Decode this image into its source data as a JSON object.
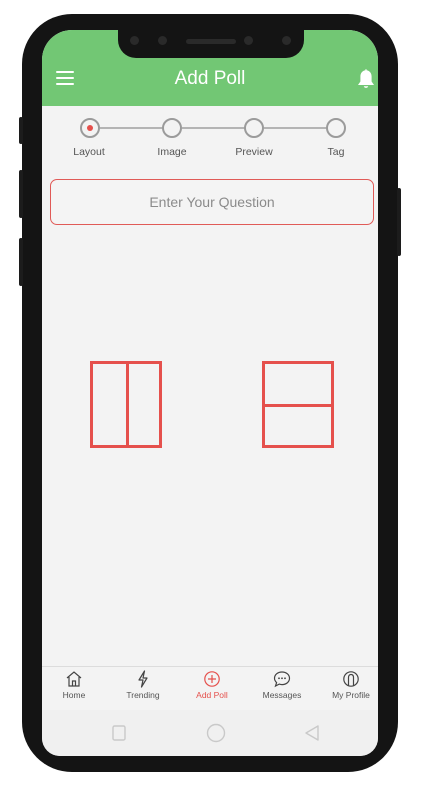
{
  "header": {
    "title": "Add Poll",
    "menu_icon": "hamburger-menu-icon",
    "bell_icon": "bell-icon"
  },
  "stepper": {
    "steps": [
      {
        "label": "Layout",
        "active": true
      },
      {
        "label": "Image",
        "active": false
      },
      {
        "label": "Preview",
        "active": false
      },
      {
        "label": "Tag",
        "active": false
      }
    ]
  },
  "question": {
    "placeholder": "Enter Your Question"
  },
  "layouts": [
    {
      "name": "two-columns",
      "icon": "split-vertical-layout-icon"
    },
    {
      "name": "two-rows",
      "icon": "split-horizontal-layout-icon"
    }
  ],
  "tabbar": {
    "tabs": [
      {
        "label": "Home",
        "icon": "home-icon"
      },
      {
        "label": "Trending",
        "icon": "lightning-icon"
      },
      {
        "label": "Add Poll",
        "icon": "plus-circle-icon",
        "active": true
      },
      {
        "label": "Messages",
        "icon": "chat-bubble-icon"
      },
      {
        "label": "My Profile",
        "icon": "profile-icon"
      }
    ]
  },
  "navbar": {
    "buttons": [
      "recent-apps-icon",
      "home-circle-icon",
      "back-triangle-icon"
    ]
  },
  "colors": {
    "header": "#72c774",
    "accent": "#e5504c",
    "phone": "#141414",
    "screen": "#f3f3f3"
  }
}
